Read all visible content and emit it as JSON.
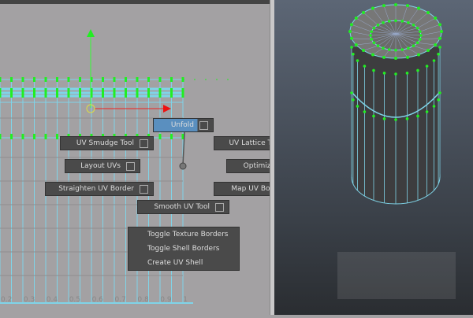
{
  "marking_menu": {
    "unfold": "Unfold",
    "uv_smudge": "UV Smudge Tool",
    "uv_lattice": "UV Lattice Tool",
    "layout_uvs": "Layout UVs",
    "optimize": "Optimize",
    "straighten": "Straighten UV Border",
    "map_border": "Map UV Border",
    "smooth": "Smooth UV Tool"
  },
  "context_menu": [
    "Toggle Texture Borders",
    "Toggle Shell Borders",
    "Create UV Shell"
  ],
  "axis_ticks": [
    "0.2",
    "0.3",
    "0.4",
    "0.5",
    "0.6",
    "0.7",
    "0.8",
    "0.9",
    "1"
  ],
  "colors": {
    "accent": "#5a8fbf",
    "uv_selected": "#22ee22",
    "wire": "#7fd4e8"
  }
}
